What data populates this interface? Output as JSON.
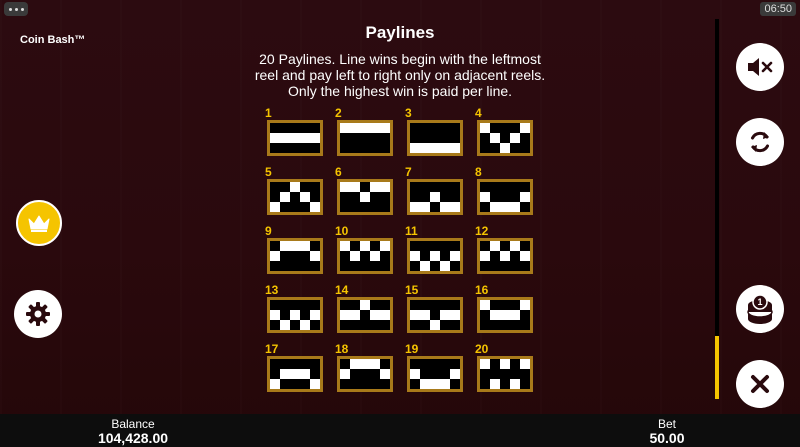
{
  "app": {
    "title": "Coin Bash™",
    "clock": "06:50"
  },
  "panel": {
    "title": "Paylines",
    "description_lines": [
      "20 Paylines. Line wins begin with the leftmost",
      "reel and pay left to right only on adjacent reels.",
      "Only the highest win is paid per line."
    ]
  },
  "paylines": [
    {
      "number": "1",
      "rows": [
        1,
        1,
        1,
        1,
        1
      ]
    },
    {
      "number": "2",
      "rows": [
        0,
        0,
        0,
        0,
        0
      ]
    },
    {
      "number": "3",
      "rows": [
        2,
        2,
        2,
        2,
        2
      ]
    },
    {
      "number": "4",
      "rows": [
        0,
        1,
        2,
        1,
        0
      ]
    },
    {
      "number": "5",
      "rows": [
        2,
        1,
        0,
        1,
        2
      ]
    },
    {
      "number": "6",
      "rows": [
        0,
        0,
        1,
        0,
        0
      ]
    },
    {
      "number": "7",
      "rows": [
        2,
        2,
        1,
        2,
        2
      ]
    },
    {
      "number": "8",
      "rows": [
        1,
        2,
        2,
        2,
        1
      ]
    },
    {
      "number": "9",
      "rows": [
        1,
        0,
        0,
        0,
        1
      ]
    },
    {
      "number": "10",
      "rows": [
        0,
        1,
        0,
        1,
        0
      ]
    },
    {
      "number": "11",
      "rows": [
        1,
        2,
        1,
        2,
        1
      ]
    },
    {
      "number": "12",
      "rows": [
        1,
        0,
        1,
        0,
        1
      ]
    },
    {
      "number": "13",
      "rows": [
        1,
        2,
        1,
        2,
        1
      ]
    },
    {
      "number": "14",
      "rows": [
        1,
        1,
        0,
        1,
        1
      ]
    },
    {
      "number": "15",
      "rows": [
        1,
        1,
        2,
        1,
        1
      ]
    },
    {
      "number": "16",
      "rows": [
        0,
        1,
        1,
        1,
        0
      ]
    },
    {
      "number": "17",
      "rows": [
        2,
        1,
        1,
        1,
        2
      ]
    },
    {
      "number": "18",
      "rows": [
        1,
        0,
        0,
        0,
        1
      ]
    },
    {
      "number": "19",
      "rows": [
        1,
        2,
        2,
        2,
        1
      ]
    },
    {
      "number": "20",
      "rows": [
        0,
        2,
        0,
        2,
        0
      ]
    }
  ],
  "footer": {
    "balance_label": "Balance",
    "balance_value": "104,428.00",
    "bet_label": "Bet",
    "bet_value": "50.00"
  },
  "icons": {
    "menu": "menu-dots-icon",
    "crown": "crown-icon",
    "settings": "gear-icon",
    "mute": "speaker-muted-icon",
    "autoplay": "refresh-icon",
    "bet": "coin-stack-icon",
    "close": "close-icon"
  },
  "colors": {
    "accent": "#f5c400",
    "frame": "#a87a1a",
    "background": "#2a0a0e"
  },
  "scroll": {
    "position_fraction": 0.83
  }
}
